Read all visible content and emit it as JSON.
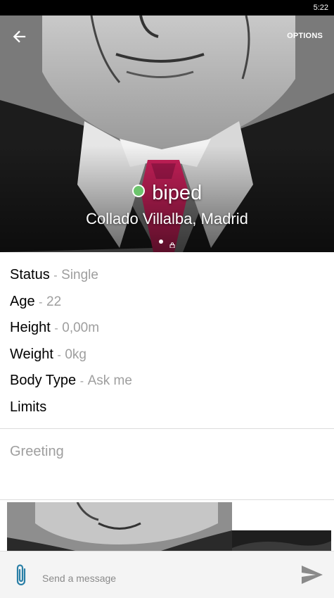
{
  "status_bar": {
    "time": "5:22"
  },
  "header": {
    "back_icon": "arrow-left-icon",
    "options_label": "OPTIONS"
  },
  "profile": {
    "name": "biped",
    "online_status_color": "#6cc46c",
    "location": "Collado Villalba, Madrid",
    "photo_pages": {
      "total": 2,
      "current": 1
    }
  },
  "details": [
    {
      "label": "Status",
      "sep": "-",
      "value": "Single"
    },
    {
      "label": "Age",
      "sep": "-",
      "value": "22"
    },
    {
      "label": "Height",
      "sep": "-",
      "value": "0,00m"
    },
    {
      "label": "Weight",
      "sep": "-",
      "value": "0kg"
    },
    {
      "label": "Body Type",
      "sep": "-",
      "value": "Ask me"
    },
    {
      "label": "Limits",
      "sep": "",
      "value": ""
    }
  ],
  "greeting": {
    "placeholder": "Greeting"
  },
  "composer": {
    "attach_icon": "paperclip-icon",
    "message_placeholder": "Send a message",
    "send_icon": "send-icon",
    "accent_color": "#2a7fa6"
  }
}
